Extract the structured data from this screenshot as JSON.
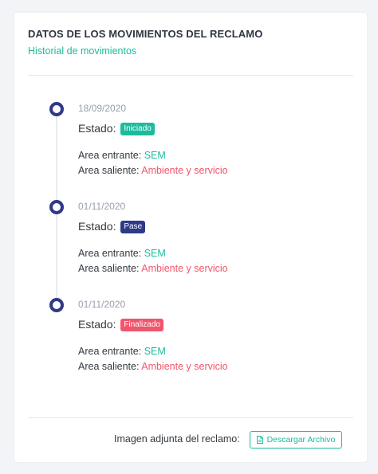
{
  "card": {
    "title": "DATOS DE LOS MOVIMIENTOS DEL RECLAMO",
    "subtitle": "Historial de movimientos"
  },
  "timeline": [
    {
      "date": "18/09/2020",
      "estado_label": "Estado:",
      "estado_value": "Iniciado",
      "estado_color": "#1abc9c",
      "area_entrante_label": "Area entrante:",
      "area_entrante_value": "SEM",
      "area_saliente_label": "Area saliente:",
      "area_saliente_value": "Ambiente y servicio"
    },
    {
      "date": "01/11/2020",
      "estado_label": "Estado:",
      "estado_value": "Pase",
      "estado_color": "#2e3a87",
      "area_entrante_label": "Area entrante:",
      "area_entrante_value": "SEM",
      "area_saliente_label": "Area saliente:",
      "area_saliente_value": "Ambiente y servicio"
    },
    {
      "date": "01/11/2020",
      "estado_label": "Estado:",
      "estado_value": "Finalizado",
      "estado_color": "#f1556c",
      "area_entrante_label": "Area entrante:",
      "area_entrante_value": "SEM",
      "area_saliente_label": "Area saliente:",
      "area_saliente_value": "Ambiente y servicio"
    }
  ],
  "footer": {
    "label": "Imagen adjunta del reclamo:",
    "download_button": "Descargar Archivo",
    "download_icon": "file-icon"
  },
  "colors": {
    "accent": "#1abc9c",
    "primary": "#2e3a87",
    "danger": "#f1556c"
  }
}
